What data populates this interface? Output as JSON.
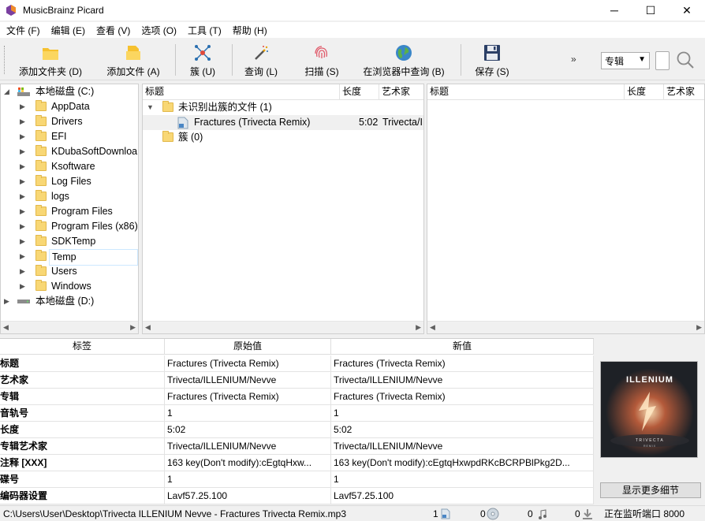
{
  "window": {
    "title": "MusicBrainz Picard"
  },
  "menu": [
    "文件 (F)",
    "编辑 (E)",
    "查看 (V)",
    "选项 (O)",
    "工具 (T)",
    "帮助 (H)"
  ],
  "toolbar": {
    "add_folder": "添加文件夹 (D)",
    "add_files": "添加文件 (A)",
    "cluster": "簇 (U)",
    "lookup": "查询 (L)",
    "scan": "扫描 (S)",
    "browser_lookup": "在浏览器中查询 (B)",
    "save": "保存 (S)",
    "more": "»",
    "album_select": "专辑"
  },
  "file_tree": {
    "drive_c": "本地磁盘 (C:)",
    "folders": [
      "AppData",
      "Drivers",
      "EFI",
      "KDubaSoftDownloa",
      "Ksoftware",
      "Log Files",
      "logs",
      "Program Files",
      "Program Files (x86)",
      "SDKTemp",
      "Temp",
      "Users",
      "Windows"
    ],
    "drive_d": "本地磁盘 (D:)"
  },
  "cluster_pane": {
    "headers": {
      "title": "标题",
      "length": "长度",
      "artist": "艺术家"
    },
    "unclustered": "未识别出簇的文件 (1)",
    "file": {
      "title": "Fractures (Trivecta Remix)",
      "length": "5:02",
      "artist": "Trivecta/I"
    },
    "clusters": "簇 (0)"
  },
  "album_pane": {
    "headers": {
      "title": "标题",
      "length": "长度",
      "artist": "艺术家"
    }
  },
  "metadata": {
    "headers": {
      "tag": "标签",
      "original": "原始值",
      "new": "新值"
    },
    "rows": [
      {
        "tag": "标题",
        "original": "Fractures (Trivecta Remix)",
        "new": "Fractures (Trivecta Remix)"
      },
      {
        "tag": "艺术家",
        "original": "Trivecta/ILLENIUM/Nevve",
        "new": "Trivecta/ILLENIUM/Nevve"
      },
      {
        "tag": "专辑",
        "original": "Fractures (Trivecta Remix)",
        "new": "Fractures (Trivecta Remix)"
      },
      {
        "tag": "音轨号",
        "original": "1",
        "new": "1"
      },
      {
        "tag": "长度",
        "original": "5:02",
        "new": "5:02"
      },
      {
        "tag": "专辑艺术家",
        "original": "Trivecta/ILLENIUM/Nevve",
        "new": "Trivecta/ILLENIUM/Nevve"
      },
      {
        "tag": "注释 [XXX]",
        "original": "163 key(Don't modify):cEgtqHxw...",
        "new": "163 key(Don't modify):cEgtqHxwpdRKcBCRPBlPkg2D..."
      },
      {
        "tag": "碟号",
        "original": "1",
        "new": "1"
      },
      {
        "tag": "编码器设置",
        "original": "Lavf57.25.100",
        "new": "Lavf57.25.100"
      }
    ]
  },
  "cover": {
    "brand": "ILLENIUM",
    "subtitle": "TRIVECTA",
    "small": "REMIX"
  },
  "more_details": "显示更多细节",
  "status": {
    "path": "C:\\Users\\User\\Desktop\\Trivecta ILLENIUM Nevve - Fractures Trivecta Remix.mp3",
    "files": "1",
    "albums": "0",
    "pending": "0",
    "downloads": "0",
    "listening": "正在监听端口 8000"
  },
  "colors": {
    "folder": "#f8d775",
    "selected_row": "#f0f0f0",
    "accent": "#0078d7"
  }
}
